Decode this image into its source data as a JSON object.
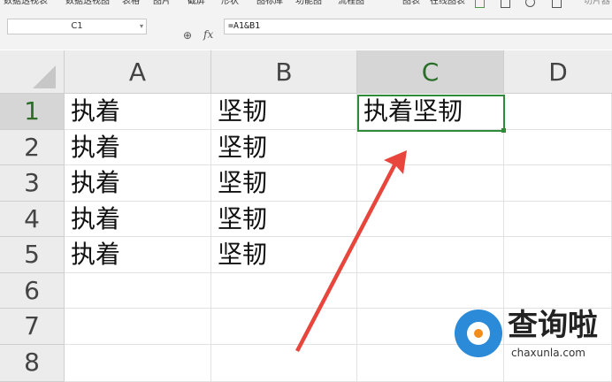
{
  "toolbar": {
    "items": [
      "数据透视表",
      "数据透视图",
      "表格",
      "图片",
      "截屏",
      "形状",
      "图标库",
      "功能图",
      "流程图",
      "图表",
      "在线图表",
      "切片器"
    ]
  },
  "formula_bar": {
    "name_box": "C1",
    "zoom_icon": "magnifier-icon",
    "fx_label": "fx",
    "formula": "=A1&B1"
  },
  "sheet": {
    "columns": [
      "A",
      "B",
      "C",
      "D"
    ],
    "active_column": "C",
    "rows": [
      "1",
      "2",
      "3",
      "4",
      "5",
      "6",
      "7",
      "8"
    ],
    "active_row": "1",
    "cells": [
      [
        "执着",
        "坚韧",
        "执着坚韧",
        ""
      ],
      [
        "执着",
        "坚韧",
        "",
        ""
      ],
      [
        "执着",
        "坚韧",
        "",
        ""
      ],
      [
        "执着",
        "坚韧",
        "",
        ""
      ],
      [
        "执着",
        "坚韧",
        "",
        ""
      ],
      [
        "",
        "",
        "",
        ""
      ],
      [
        "",
        "",
        "",
        ""
      ],
      [
        "",
        "",
        "",
        ""
      ]
    ],
    "selection_color": "#2e8b3a",
    "arrow_color": "#e8463c"
  },
  "watermark": {
    "title": "查询啦",
    "url": "chaxunla.com"
  }
}
